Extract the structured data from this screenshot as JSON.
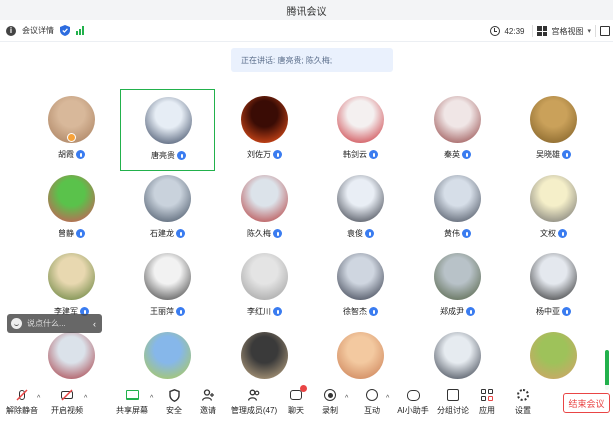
{
  "window": {
    "title": "腾讯会议"
  },
  "toolbar": {
    "info_label": "会议详情",
    "time": "42:39",
    "view_label": "宫格视图"
  },
  "speaking": {
    "text": "正在讲话: 唐亮贵; 陈久梅;"
  },
  "participants": [
    {
      "name": "胡霞",
      "mic": true,
      "active": false,
      "hand": true,
      "color1": "#d8b89a",
      "color2": "#a57b5a"
    },
    {
      "name": "唐亮贵",
      "mic": true,
      "active": true,
      "hand": false,
      "color1": "#e6edf5",
      "color2": "#2b3a55"
    },
    {
      "name": "刘佐万",
      "mic": true,
      "active": false,
      "hand": false,
      "color1": "#3a0c05",
      "color2": "#ff5a1e"
    },
    {
      "name": "韩剑云",
      "mic": true,
      "active": false,
      "hand": false,
      "color1": "#f4f0f0",
      "color2": "#c7262e"
    },
    {
      "name": "秦英",
      "mic": true,
      "active": false,
      "hand": false,
      "color1": "#f0e6e6",
      "color2": "#8c3a3a"
    },
    {
      "name": "吴晓雄",
      "mic": true,
      "active": false,
      "hand": false,
      "color1": "#caa15a",
      "color2": "#7a5a22"
    },
    {
      "name": "曾静",
      "mic": true,
      "active": false,
      "hand": false,
      "color1": "#5ac24b",
      "color2": "#e04a5a"
    },
    {
      "name": "石建龙",
      "mic": true,
      "active": false,
      "hand": false,
      "color1": "#c9d2dc",
      "color2": "#3c4a5c"
    },
    {
      "name": "陈久梅",
      "mic": true,
      "active": false,
      "hand": false,
      "color1": "#dce3ea",
      "color2": "#b23030"
    },
    {
      "name": "袁俊",
      "mic": true,
      "active": false,
      "hand": false,
      "color1": "#e9eef5",
      "color2": "#2a2f3a"
    },
    {
      "name": "黄伟",
      "mic": true,
      "active": false,
      "hand": false,
      "color1": "#d6dee8",
      "color2": "#3a4250"
    },
    {
      "name": "文权",
      "mic": true,
      "active": false,
      "hand": false,
      "color1": "#f5efc9",
      "color2": "#6a6a6a"
    },
    {
      "name": "李建军",
      "mic": true,
      "active": false,
      "hand": false,
      "color1": "#e8d8b0",
      "color2": "#5a7a32"
    },
    {
      "name": "王丽萍",
      "mic": true,
      "active": false,
      "hand": false,
      "color1": "#f2f2f2",
      "color2": "#333333"
    },
    {
      "name": "李红川",
      "mic": true,
      "active": false,
      "hand": false,
      "color1": "#e4e4e4",
      "color2": "#9a9a9a"
    },
    {
      "name": "徐智杰",
      "mic": true,
      "active": false,
      "hand": false,
      "color1": "#cfd6e0",
      "color2": "#2a3040"
    },
    {
      "name": "郑成尹",
      "mic": true,
      "active": false,
      "hand": false,
      "color1": "#b8c2c8",
      "color2": "#4a5a3a"
    },
    {
      "name": "杨中亚",
      "mic": true,
      "active": false,
      "hand": false,
      "color1": "#e4e8ee",
      "color2": "#222222"
    },
    {
      "name": "",
      "mic": false,
      "active": false,
      "hand": false,
      "color1": "#dbe2ea",
      "color2": "#a3313a"
    },
    {
      "name": "",
      "mic": false,
      "active": false,
      "hand": false,
      "color1": "#86b7ea",
      "color2": "#b0cc4a"
    },
    {
      "name": "",
      "mic": false,
      "active": false,
      "hand": false,
      "color1": "#3a3a3a",
      "color2": "#c9b08a"
    },
    {
      "name": "",
      "mic": false,
      "active": false,
      "hand": false,
      "color1": "#f3c9a0",
      "color2": "#c87a50"
    },
    {
      "name": "",
      "mic": false,
      "active": false,
      "hand": false,
      "color1": "#e6ebf0",
      "color2": "#2c3340"
    },
    {
      "name": "",
      "mic": false,
      "active": false,
      "hand": false,
      "color1": "#9ec25a",
      "color2": "#d8a06a"
    }
  ],
  "chat": {
    "placeholder": "说点什么..."
  },
  "bottombar": {
    "mute": "解除静音",
    "video": "开启视频",
    "share": "共享屏幕",
    "security": "安全",
    "invite": "邀请",
    "members": "管理成员(47)",
    "chat": "聊天",
    "record": "录制",
    "interact": "互动",
    "ai": "AI小助手",
    "breakout": "分组讨论",
    "apps": "应用",
    "settings": "设置",
    "end": "结束会议"
  }
}
